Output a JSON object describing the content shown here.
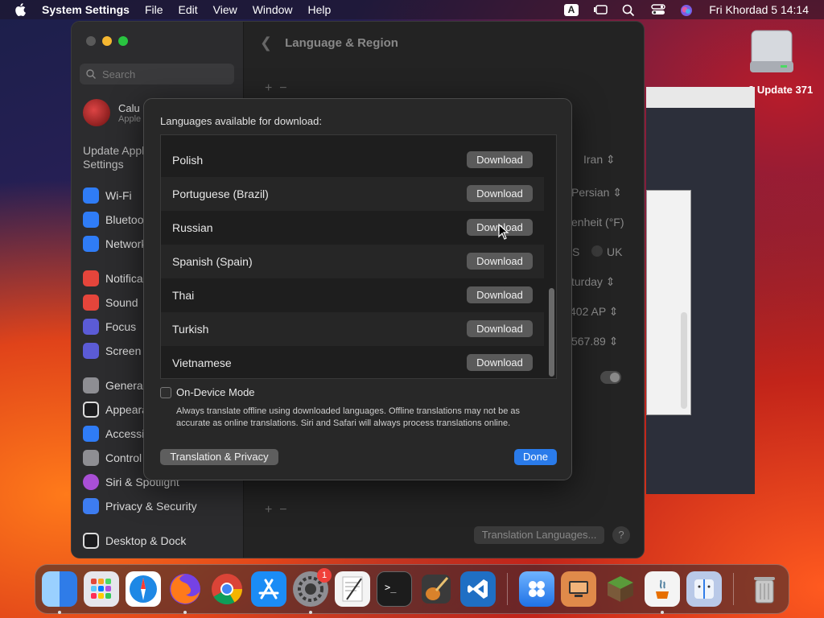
{
  "menubar": {
    "app_name": "System Settings",
    "menus": [
      "File",
      "Edit",
      "View",
      "Window",
      "Help"
    ],
    "input_source": "A",
    "datetime": "Fri Khordad 5  14:14"
  },
  "desktop": {
    "disk_label": "3 Update 371"
  },
  "settings": {
    "search_placeholder": "Search",
    "user_name": "Calu",
    "user_sub": "Apple",
    "update_text": "Update Appl Settings",
    "sidebar_items": [
      {
        "label": "Wi-Fi",
        "color": "#2f7cf6"
      },
      {
        "label": "Bluetoo",
        "color": "#2f7cf6"
      },
      {
        "label": "Network",
        "color": "#2f7cf6"
      },
      {
        "label": "Notifica",
        "color": "#e5453b"
      },
      {
        "label": "Sound",
        "color": "#e5453b"
      },
      {
        "label": "Focus",
        "color": "#5b5bd6"
      },
      {
        "label": "Screen",
        "color": "#5b5bd6"
      },
      {
        "label": "General",
        "color": "#8e8e93"
      },
      {
        "label": "Appeara",
        "color": "#2c2c2e"
      },
      {
        "label": "Accessi",
        "color": "#2f7cf6"
      },
      {
        "label": "Control",
        "color": "#8e8e93"
      },
      {
        "label": "Siri & Spotlight",
        "color": "#a94fd6"
      },
      {
        "label": "Privacy & Security",
        "color": "#3d7cf0"
      },
      {
        "label": "Desktop & Dock",
        "color": "#2c2c2e"
      }
    ],
    "page_title": "Language & Region",
    "right_values": [
      "Iran",
      "Persian",
      "enheit (°F)",
      "S",
      "UK",
      "turday",
      "402 AP",
      "567.89"
    ],
    "translation_languages_btn": "Translation Languages...",
    "help": "?"
  },
  "sheet": {
    "title": "Languages available for download:",
    "languages": [
      {
        "name": "Polish",
        "action": "Download"
      },
      {
        "name": "Portuguese (Brazil)",
        "action": "Download"
      },
      {
        "name": "Russian",
        "action": "Download"
      },
      {
        "name": "Spanish (Spain)",
        "action": "Download"
      },
      {
        "name": "Thai",
        "action": "Download"
      },
      {
        "name": "Turkish",
        "action": "Download"
      },
      {
        "name": "Vietnamese",
        "action": "Download"
      }
    ],
    "on_device_label": "On-Device Mode",
    "on_device_desc": "Always translate offline using downloaded languages. Offline translations may not be as accurate as online translations. Siri and Safari will always process translations online.",
    "translation_privacy_btn": "Translation & Privacy",
    "done_btn": "Done"
  },
  "dock": {
    "apps": [
      {
        "name": "finder-icon",
        "color": "#3a8ef0"
      },
      {
        "name": "launchpad-icon",
        "color": "#e9e9ee"
      },
      {
        "name": "safari-icon",
        "color": "#1e88e5"
      },
      {
        "name": "firefox-icon",
        "color": "#ff7a1a"
      },
      {
        "name": "chrome-icon",
        "color": "#ffffff"
      },
      {
        "name": "app-store-icon",
        "color": "#1b8cf5"
      },
      {
        "name": "system-settings-icon",
        "color": "#8e8e93"
      },
      {
        "name": "textedit-icon",
        "color": "#f4f4f4"
      },
      {
        "name": "terminal-icon",
        "color": "#1c1c1c"
      },
      {
        "name": "garageband-icon",
        "color": "#3a3a3a"
      },
      {
        "name": "vscode-icon",
        "color": "#1f6fc4"
      },
      {
        "name": "app-folder-icon",
        "color": "#1f72e6"
      },
      {
        "name": "monitor-icon",
        "color": "#e08a4a"
      },
      {
        "name": "minecraft-icon",
        "color": "#5a9a3a"
      },
      {
        "name": "java-icon",
        "color": "#f4f4f4"
      },
      {
        "name": "finder-alt-icon",
        "color": "#b9c9e8"
      },
      {
        "name": "trash-icon",
        "color": "#8a8a8a"
      }
    ],
    "settings_badge": "1"
  }
}
